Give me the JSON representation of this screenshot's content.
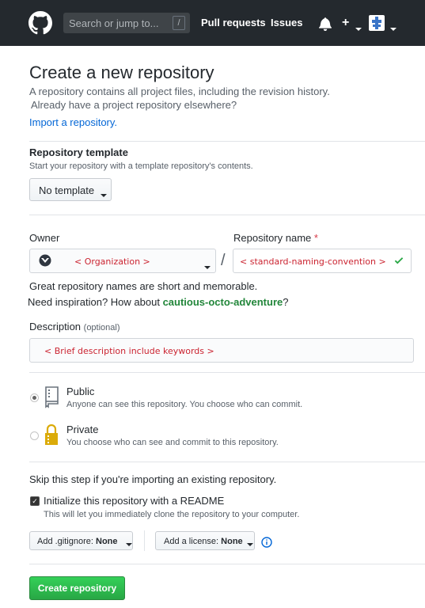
{
  "header": {
    "search_placeholder": "Search or jump to...",
    "search_shortcut": "/",
    "nav": [
      {
        "label": "Pull requests"
      },
      {
        "label": "Issues"
      }
    ],
    "plus": "+"
  },
  "page": {
    "title": "Create a new repository",
    "description_line1": "A repository contains all project files, including the revision history.",
    "description_line2": "Already have a project repository elsewhere?",
    "import_link": "Import a repository."
  },
  "template": {
    "label": "Repository template",
    "note": "Start your repository with a template repository's contents.",
    "button": "No template"
  },
  "owner": {
    "label": "Owner",
    "value": "< Organization >"
  },
  "repo_name": {
    "label": "Repository name",
    "required_mark": "*",
    "value": "< standard-naming-convention >",
    "separator": "/",
    "hint": "Great repository names are short and memorable.",
    "inspiration_prefix": "Need inspiration? How about",
    "inspiration_suggestion": "cautious-octo-adventure",
    "inspiration_suffix": "?"
  },
  "description": {
    "label": "Description",
    "optional": "(optional)",
    "value": "< Brief description include keywords >"
  },
  "visibility": {
    "options": [
      {
        "label": "Public",
        "note": "Anyone can see this repository. You choose who can commit.",
        "selected": true
      },
      {
        "label": "Private",
        "note": "You choose who can see and commit to this repository.",
        "selected": false
      }
    ]
  },
  "init": {
    "skip_note": "Skip this step if you're importing an existing repository.",
    "readme_label": "Initialize this repository with a README",
    "readme_note": "This will let you immediately clone the repository to your computer.",
    "readme_checked": true,
    "gitignore_prefix": "Add .gitignore:",
    "gitignore_value": "None",
    "license_prefix": "Add a license:",
    "license_value": "None"
  },
  "submit": {
    "label": "Create repository"
  },
  "colors": {
    "header_bg": "#24292e",
    "link": "#0366d6",
    "green": "#28a745",
    "placeholder_red": "#cb2431"
  }
}
